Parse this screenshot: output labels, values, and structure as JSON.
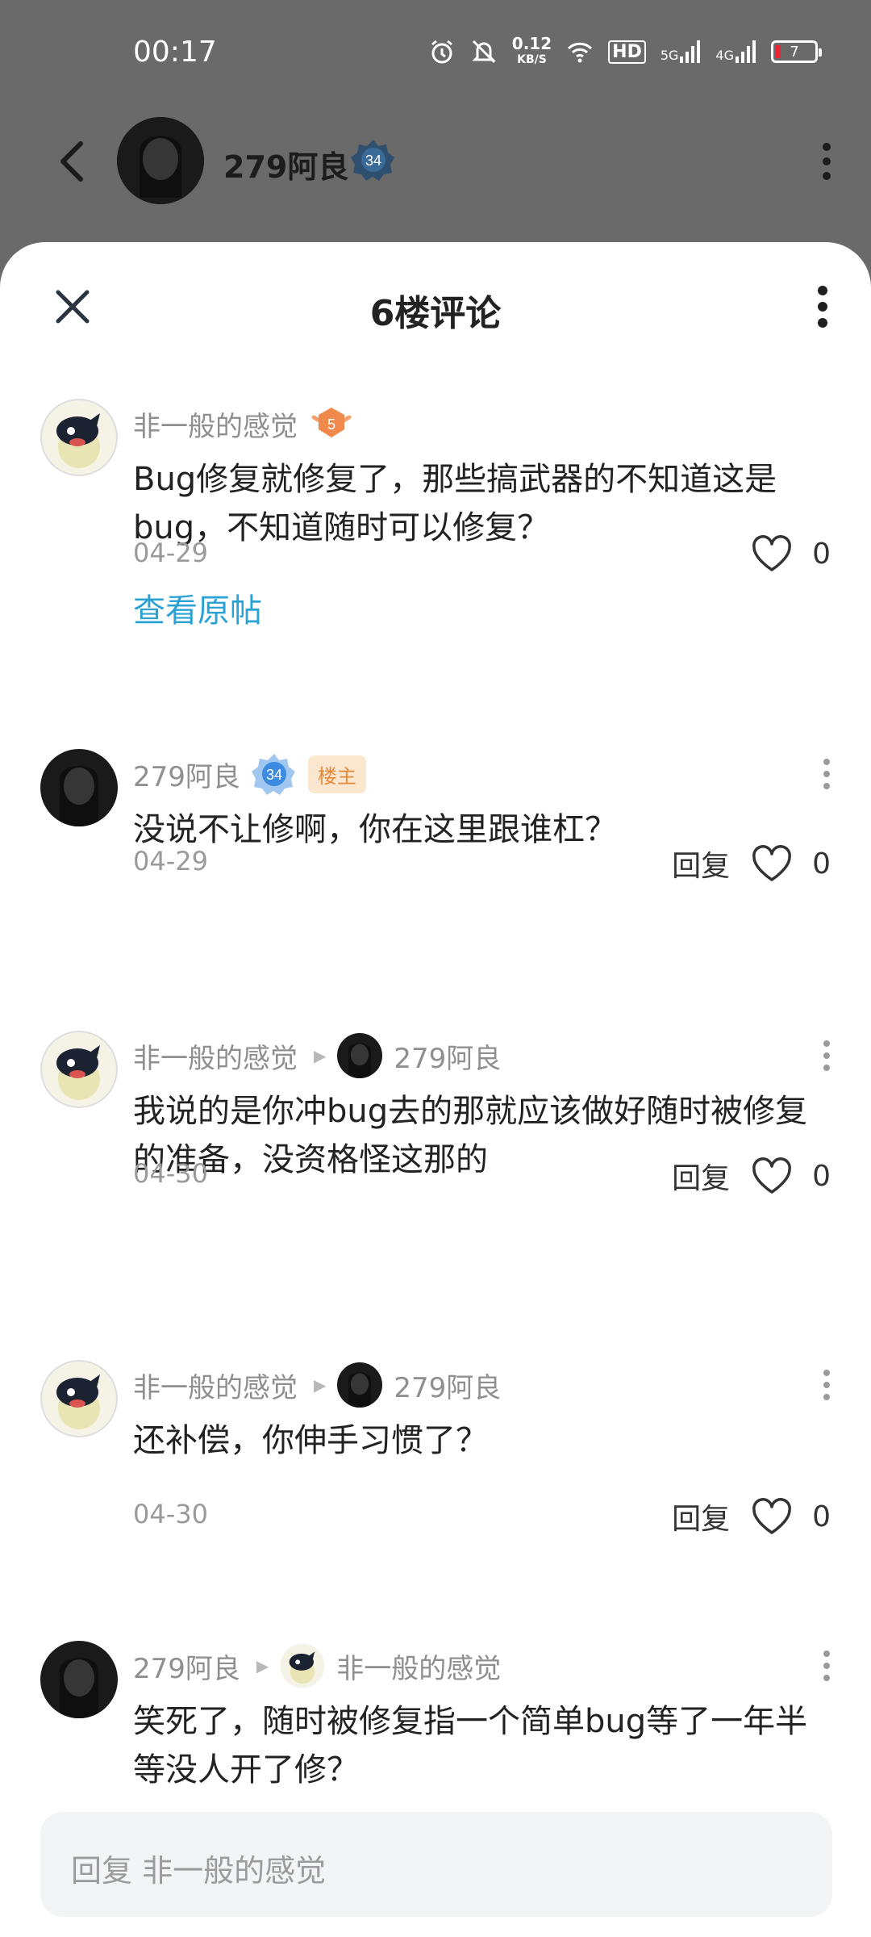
{
  "status_bar": {
    "time": "00:17",
    "net_speed_value": "0.12",
    "net_speed_unit": "KB/S",
    "hd_label": "HD",
    "signal1_label": "5G",
    "signal2_label": "4G",
    "battery": "7"
  },
  "background_header": {
    "user_name": "279阿良",
    "level": "34"
  },
  "sheet": {
    "title": "6楼评论",
    "view_original_label": "查看原帖",
    "reply_placeholder": "回复 非一般的感觉"
  },
  "comments": [
    {
      "author": "非一般的感觉",
      "level": "5",
      "text": "Bug修复就修复了，那些搞武器的不知道这是bug，不知道随时可以修复？",
      "date": "04-29",
      "likes": "0"
    },
    {
      "author": "279阿良",
      "level": "34",
      "tag": "楼主",
      "text": "没说不让修啊，你在这里跟谁杠？",
      "date": "04-29",
      "reply_label": "回复",
      "likes": "0"
    },
    {
      "author": "非一般的感觉",
      "reply_to": "279阿良",
      "text": "我说的是你冲bug去的那就应该做好随时被修复的准备，没资格怪这那的",
      "date": "04-30",
      "reply_label": "回复",
      "likes": "0"
    },
    {
      "author": "非一般的感觉",
      "reply_to": "279阿良",
      "text": "还补偿，你伸手习惯了？",
      "date": "04-30",
      "reply_label": "回复",
      "likes": "0"
    },
    {
      "author": "279阿良",
      "reply_to": "非一般的感觉",
      "text": "笑死了，随时被修复指一个简单bug等了一年半等没人开了修？"
    }
  ],
  "colors": {
    "link": "#2aa3d4",
    "owner_tag_bg": "#fbe6cf",
    "owner_tag_text": "#e58a3b",
    "overlay_bg": "#6a6a6a"
  },
  "icons": [
    "chevron-left-icon",
    "close-icon",
    "more-vertical-icon",
    "heart-icon",
    "level-badge-icon",
    "alarm-icon",
    "mute-icon",
    "wifi-icon",
    "signal-icon",
    "battery-icon"
  ]
}
